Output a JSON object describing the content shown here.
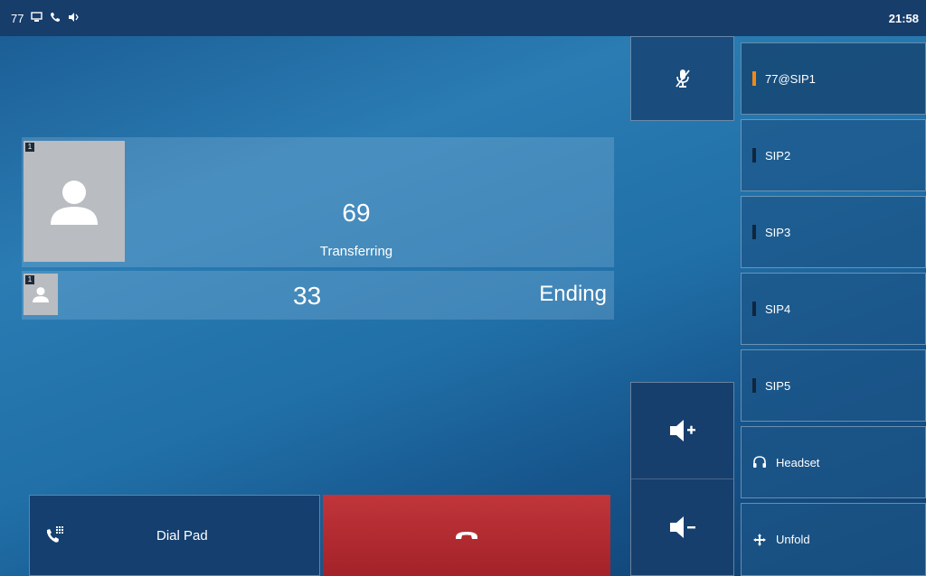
{
  "status_bar": {
    "account": "77",
    "icons": [
      "screen-icon",
      "phone-icon",
      "speaker-icon"
    ],
    "time": "21:58"
  },
  "calls": {
    "main": {
      "number": "69",
      "state": "Transferring"
    },
    "secondary": {
      "number": "33",
      "state": "Ending"
    }
  },
  "buttons": {
    "mute_icon": "mic-mute-icon",
    "volume_up_icon": "volume-up-icon",
    "volume_down_icon": "volume-down-icon",
    "dial_pad": "Dial Pad",
    "hangup_icon": "hangup-icon"
  },
  "line_keys": [
    {
      "label": "77@SIP1",
      "active": true
    },
    {
      "label": "SIP2",
      "active": false
    },
    {
      "label": "SIP3",
      "active": false
    },
    {
      "label": "SIP4",
      "active": false
    },
    {
      "label": "SIP5",
      "active": false
    },
    {
      "label": "Headset",
      "icon": "headset-icon"
    },
    {
      "label": "Unfold",
      "icon": "unfold-icon"
    }
  ],
  "colors": {
    "active_line": "#f08a16",
    "hangup": "#b52a30",
    "status_bar": "#173d6b"
  }
}
